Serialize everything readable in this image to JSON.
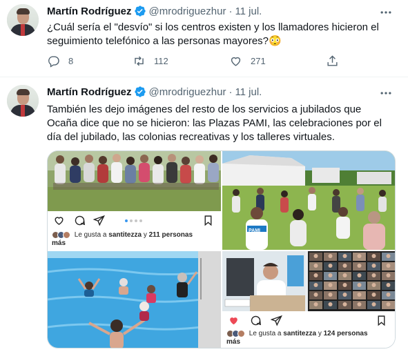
{
  "tweets": [
    {
      "author": {
        "name": "Martín Rodríguez",
        "handle": "@mrodriguezhur",
        "date": "11 jul."
      },
      "separator": "·",
      "text": "¿Cuál sería el \"desvío\" si los centros existen y los llamadores hicieron el seguimiento telefónico a las personas mayores?😳",
      "counts": {
        "replies": "8",
        "retweets": "112",
        "likes": "271"
      }
    },
    {
      "author": {
        "name": "Martín Rodríguez",
        "handle": "@mrodriguezhur",
        "date": "11 jul."
      },
      "separator": "·",
      "text": "También les dejo imágenes del resto de los servicios a jubilados que Ocaña dice que no se hicieron: las Plazas PAMI, las celebraciones por el día del jubilado, las colonias recreativas y los talleres virtuales.",
      "media": {
        "post1_likes": {
          "prefix": "Le gusta a ",
          "user": "santitezza",
          "middle": " y ",
          "count": "211 personas",
          "suffix": " más"
        },
        "post2_likes": {
          "prefix": "Le gusta a ",
          "user": "santitezza",
          "middle": " y ",
          "count": "124 personas",
          "suffix": " más"
        },
        "badge_text": "PAMI"
      }
    }
  ],
  "colors": {
    "verified": "#1d9bf0",
    "secondary_text": "#536471",
    "like_red": "#ed4956"
  }
}
